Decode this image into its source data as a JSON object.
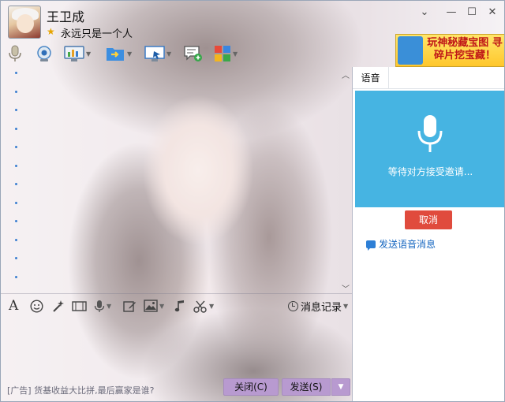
{
  "header": {
    "contact_name": "王卫成",
    "signature": "永远只是一个人"
  },
  "window_controls": {
    "minimize_arrow": "⌄",
    "minimize": "—",
    "maximize": "☐",
    "close": "✕"
  },
  "ad_banner": {
    "text": "玩神秘藏宝图 寻碎片挖宝藏！"
  },
  "toolbar": {
    "items": [
      "voice-call",
      "video-call",
      "remote-desktop",
      "send-file",
      "screen-share",
      "new-message",
      "apps"
    ]
  },
  "input_toolbar": {
    "history_label": "消息记录"
  },
  "footer": {
    "ad_text": "[广告] 货基收益大比拼,最后赢家是谁?",
    "close_label": "关闭(C)",
    "send_label": "发送(S)"
  },
  "right_panel": {
    "tab_label": "语音",
    "waiting_text": "等待对方接受邀请...",
    "cancel_label": "取消",
    "send_voice_label": "发送语音消息"
  },
  "colors": {
    "voice_panel": "#46b4e2",
    "cancel": "#e04b3d",
    "button_purple": "#b89ad0",
    "link": "#1767c0"
  }
}
